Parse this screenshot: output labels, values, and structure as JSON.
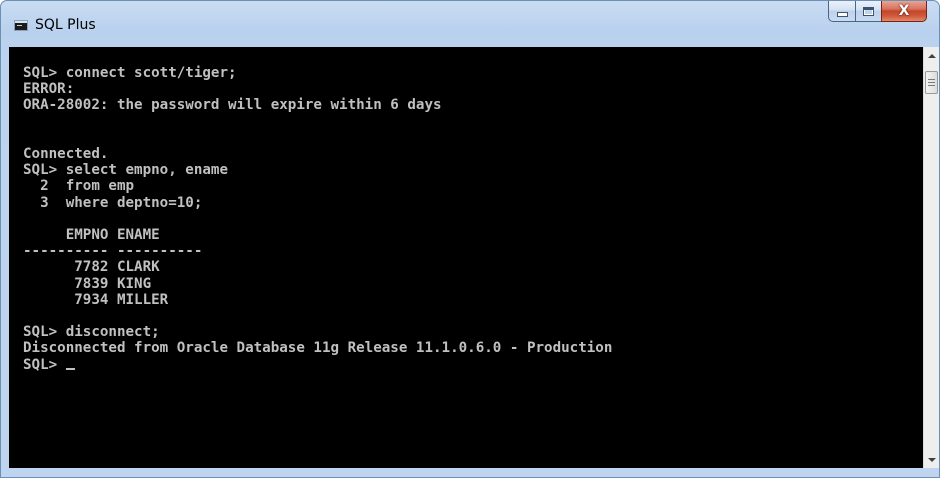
{
  "window": {
    "title": "SQL Plus",
    "app_icon": "console-window-icon",
    "controls": {
      "minimize_icon": "minimize-icon",
      "maximize_icon": "maximize-icon",
      "close_icon": "close-icon",
      "close_glyph": "X"
    }
  },
  "console": {
    "lines": [
      "SQL> connect scott/tiger;",
      "ERROR:",
      "ORA-28002: the password will expire within 6 days",
      "",
      "",
      "Connected.",
      "SQL> select empno, ename",
      "  2  from emp",
      "  3  where deptno=10;",
      "",
      "     EMPNO ENAME",
      "---------- ----------",
      "      7782 CLARK",
      "      7839 KING",
      "      7934 MILLER",
      "",
      "SQL> disconnect;",
      "Disconnected from Oracle Database 11g Release 11.1.0.6.0 - Production"
    ],
    "prompt": "SQL> "
  },
  "colors": {
    "console_background": "#000000",
    "console_text": "#c0c0c0",
    "close_button": "#c5462a"
  }
}
